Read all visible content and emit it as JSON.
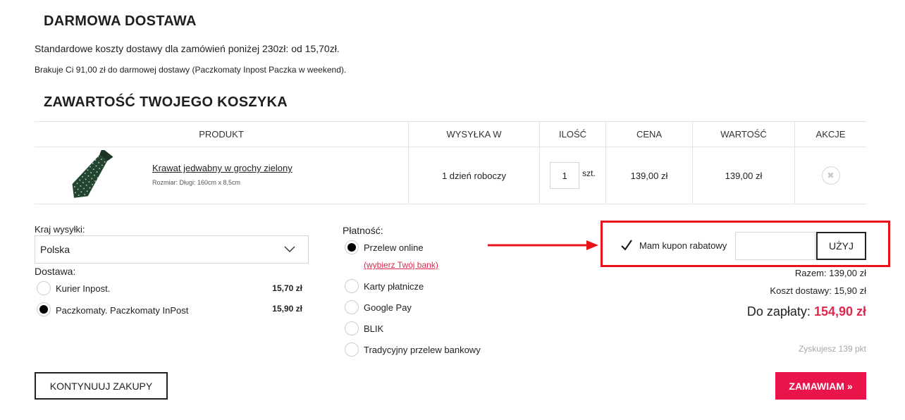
{
  "shipping_info": {
    "title": "DARMOWA DOSTAWA",
    "line1": "Standardowe koszty dostawy dla zamówień poniżej 230zł: od 15,70zł.",
    "line2": "Brakuje Ci 91,00 zł do darmowej dostawy (Paczkomaty Inpost Paczka w weekend)."
  },
  "cart": {
    "title": "ZAWARTOŚĆ TWOJEGO KOSZYKA",
    "columns": [
      "PRODUKT",
      "WYSYŁKA W",
      "ILOŚĆ",
      "CENA",
      "WARTOŚĆ",
      "AKCJE"
    ],
    "items": [
      {
        "name": "Krawat jedwabny w grochy zielony",
        "size": "Rozmiar: Długi: 160cm x 8,5cm",
        "shipping": "1 dzień roboczy",
        "quantity": "1",
        "unit": "szt.",
        "price": "139,00 zł",
        "value": "139,00 zł"
      }
    ]
  },
  "country": {
    "label": "Kraj wysyłki:",
    "selected": "Polska"
  },
  "delivery": {
    "label": "Dostawa:",
    "options": [
      {
        "label": "Kurier Inpost.",
        "price": "15,70 zł",
        "selected": false
      },
      {
        "label": "Paczkomaty. Paczkomaty InPost",
        "price": "15,90 zł",
        "selected": true
      }
    ]
  },
  "payment": {
    "label": "Płatność:",
    "options": [
      {
        "label": "Przelew online",
        "selected": true
      },
      {
        "label": "Karty płatnicze",
        "selected": false
      },
      {
        "label": "Google Pay",
        "selected": false
      },
      {
        "label": "BLIK",
        "selected": false
      },
      {
        "label": "Tradycyjny przelew bankowy",
        "selected": false
      }
    ],
    "bank_link": "(wybierz Twój bank)"
  },
  "coupon": {
    "label": "Mam kupon rabatowy",
    "input_value": "",
    "button": "UŻYJ"
  },
  "summary": {
    "subtotal": "Razem: 139,00 zł",
    "shipping_cost": "Koszt dostawy: 15,90 zł",
    "total_label": "Do zapłaty:",
    "total_value": "154,90 zł",
    "points": "Zyskujesz 139 pkt"
  },
  "buttons": {
    "continue": "KONTYNUUJ ZAKUPY",
    "order": "ZAMAWIAM »"
  },
  "colors": {
    "accent": "#e8144a",
    "highlight": "#e8141c"
  }
}
